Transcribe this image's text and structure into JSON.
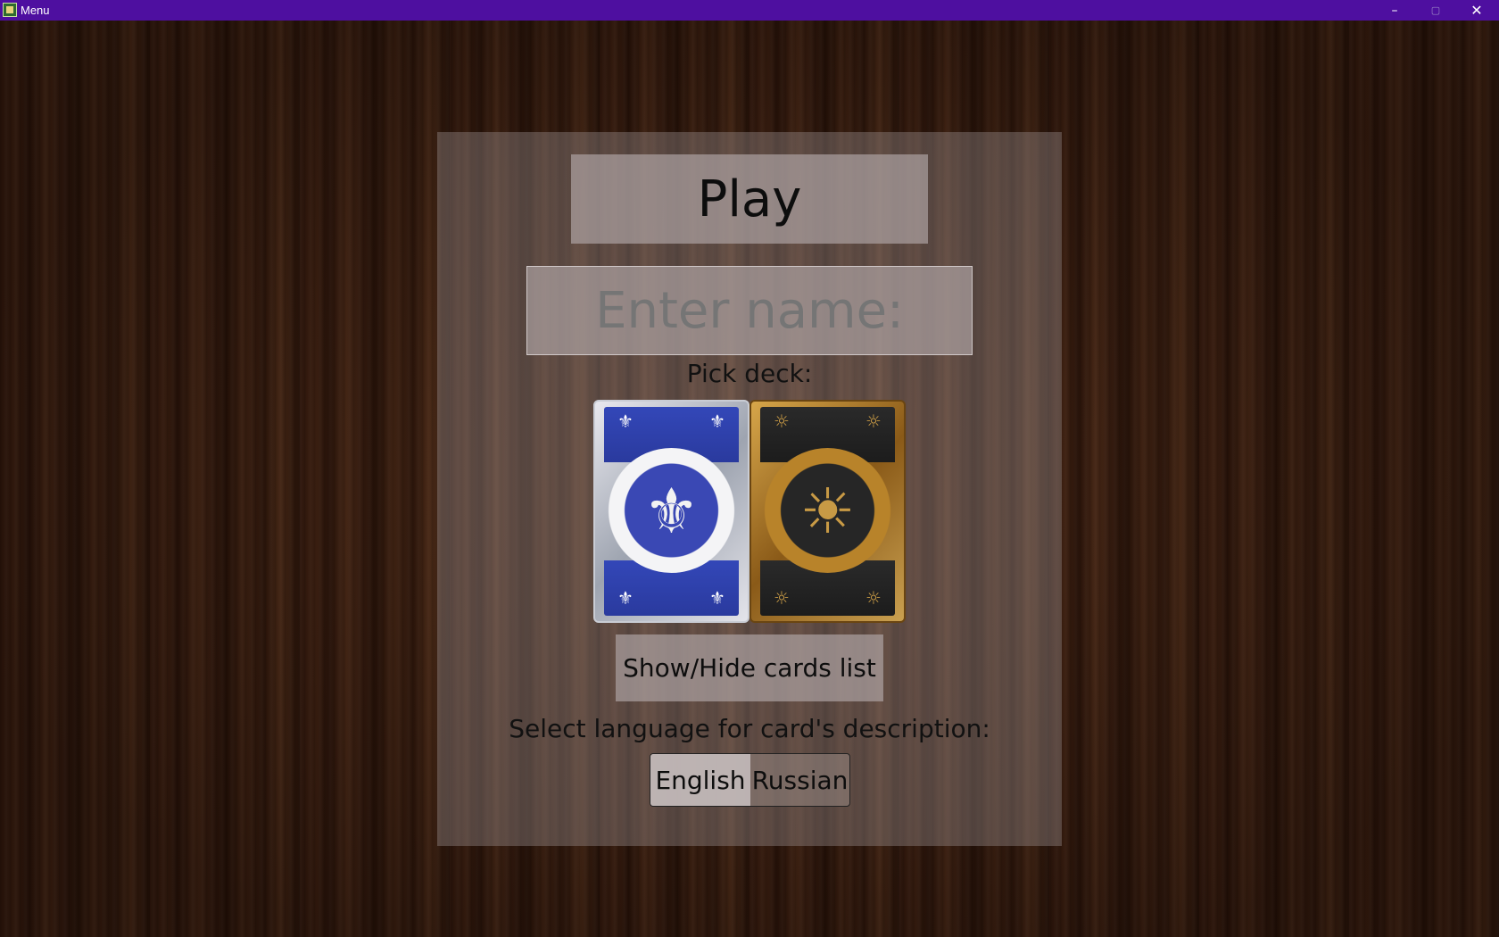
{
  "window": {
    "title": "Menu",
    "controls": {
      "minimize": "–",
      "maximize": "▢",
      "close": "✕"
    }
  },
  "menu": {
    "play_label": "Play",
    "name_placeholder": "Enter name:",
    "name_value": "",
    "pick_deck_label": "Pick deck:",
    "decks": [
      {
        "name": "blue-fleur-de-lis-deck",
        "emblem": "⚜",
        "corner": "⚜"
      },
      {
        "name": "gold-sun-deck",
        "emblem": "☀",
        "corner": "☼"
      }
    ],
    "toggle_cards_label": "Show/Hide cards list",
    "language_label": "Select language for card's description:",
    "languages": [
      "English",
      "Russian"
    ],
    "selected_language": "English"
  },
  "colors": {
    "titlebar": "#4e0fa0",
    "panel": "#a09696",
    "blue_deck": "#3347b8",
    "gold_deck": "#b8832a"
  }
}
